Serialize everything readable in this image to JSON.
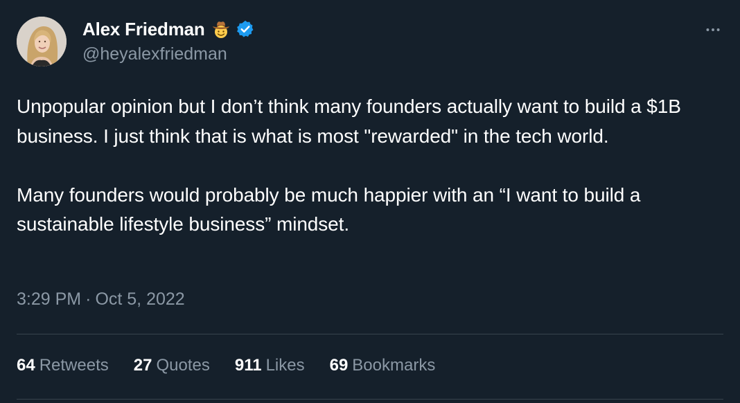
{
  "author": {
    "display_name": "Alex Friedman",
    "handle": "@heyalexfriedman",
    "emoji_icon": "cowboy-hat-face-emoji",
    "verified_icon": "verified-badge-icon",
    "verified_color": "#1d9bf0"
  },
  "tweet": {
    "paragraphs": [
      "Unpopular opinion but I don’t think many founders actually want to build a $1B business. I just think that is what is most \"rewarded\" in the tech world.",
      "Many founders would probably be much happier with an “I want to build a sustainable lifestyle business” mindset."
    ],
    "time": "3:29 PM",
    "separator": "·",
    "date": "Oct 5, 2022"
  },
  "stats": [
    {
      "count": "64",
      "label": "Retweets"
    },
    {
      "count": "27",
      "label": "Quotes"
    },
    {
      "count": "911",
      "label": "Likes"
    },
    {
      "count": "69",
      "label": "Bookmarks"
    }
  ],
  "colors": {
    "background": "#15202b",
    "text": "#ffffff",
    "secondary_text": "#8b98a5",
    "divider": "#38444d"
  }
}
